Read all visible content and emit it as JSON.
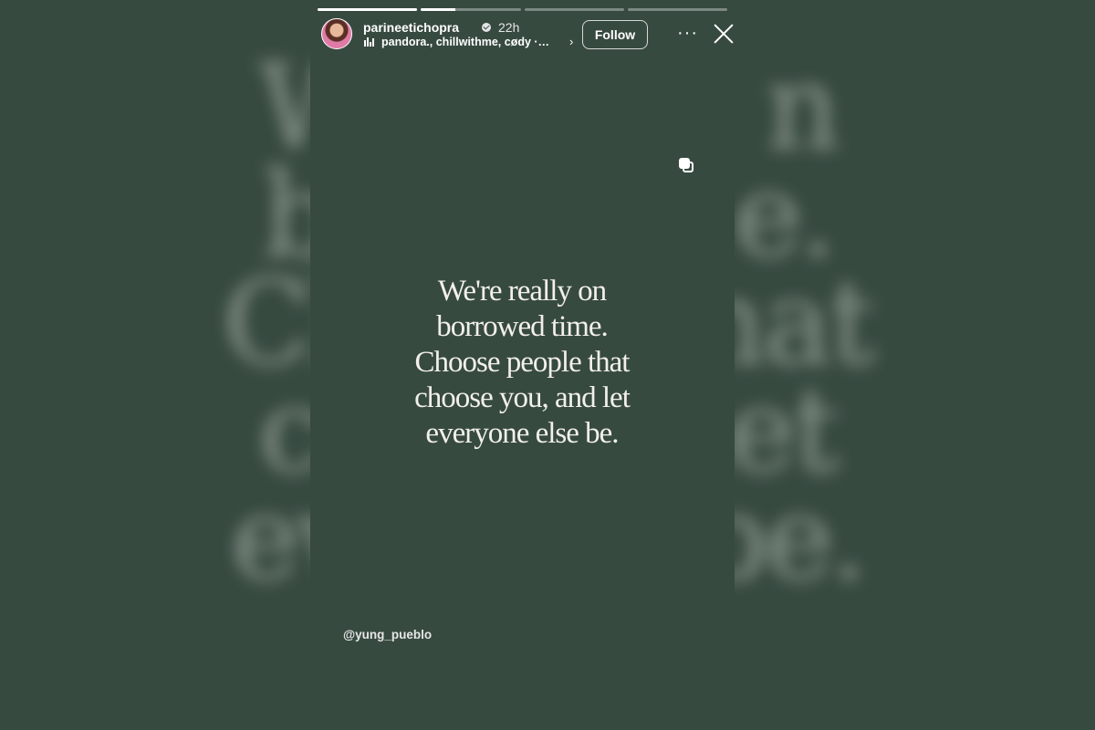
{
  "background_text": [
    "We",
    "be",
    "Ch",
    "that",
    "ch",
    "let",
    "ev",
    "be."
  ],
  "story": {
    "progress_segments": [
      1,
      1,
      0,
      0
    ],
    "progress_active": 0.35,
    "user": {
      "username": "parineetichopra",
      "time": "22h",
      "music": "pandora., chillwithme, cødy ·…"
    },
    "follow_label": "Follow",
    "more_label": "···",
    "quote_lines": [
      "We're really on",
      "borrowed time.",
      "Choose people that",
      "choose you, and let",
      "everyone else be."
    ],
    "attribution": "@yung_pueblo"
  },
  "colors": {
    "background": "#374a40",
    "text": "#f2f0ea"
  },
  "icons": [
    "avatar",
    "verified-icon",
    "music-icon",
    "chevron-right-icon",
    "more-icon",
    "close-icon",
    "carousel-icon"
  ]
}
